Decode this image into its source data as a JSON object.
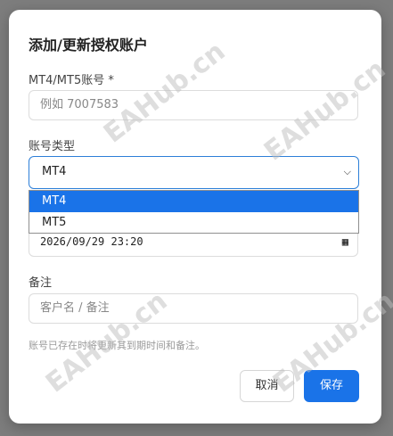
{
  "dialog": {
    "title": "添加/更新授权账户",
    "account_label": "MT4/MT5账号 *",
    "account_placeholder": "例如 7007583",
    "type_label": "账号类型",
    "type_selected": "MT4",
    "type_options": [
      "MT4",
      "MT5"
    ],
    "expiry_value": "2026/09/29 23:20",
    "note_label": "备注",
    "note_placeholder": "客户名 / 备注",
    "hint": "账号已存在时将更新其到期时间和备注。",
    "cancel_label": "取消",
    "save_label": "保存"
  },
  "watermark": "EAHub.cn",
  "colors": {
    "accent": "#1a73e8",
    "overlay": "#7d7d7d"
  }
}
